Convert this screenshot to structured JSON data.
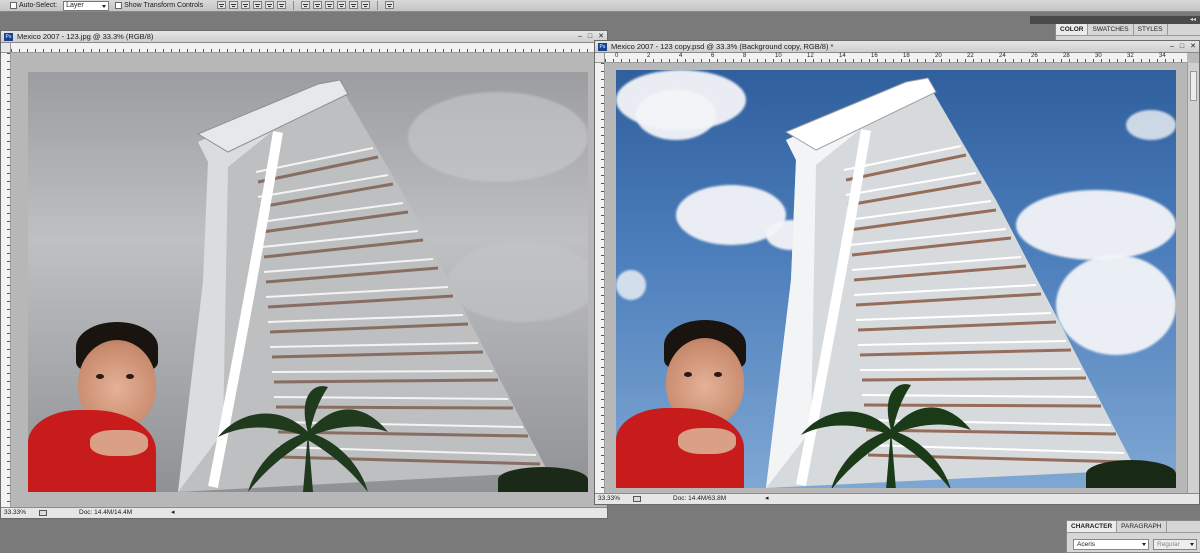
{
  "options_bar": {
    "auto_select_label": "Auto-Select:",
    "auto_select_value": "Layer",
    "show_transform_label": "Show Transform Controls"
  },
  "windows": [
    {
      "title": "Mexico 2007 - 123.jpg @ 33.3% (RGB/8)",
      "zoom": "33.33%",
      "doc_size": "Doc: 14.4M/14.4M"
    },
    {
      "title": "Mexico 2007 - 123 copy.psd @ 33.3% (Background copy, RGB/8) *",
      "zoom": "33.33%",
      "doc_size": "Doc: 14.4M/63.8M",
      "ruler_labels": [
        "0",
        "2",
        "4",
        "6",
        "8",
        "10",
        "12",
        "14",
        "16",
        "18",
        "20",
        "22",
        "24",
        "26",
        "28",
        "30",
        "32",
        "34"
      ]
    }
  ],
  "panels": {
    "color_tabs": [
      "COLOR",
      "SWATCHES",
      "STYLES"
    ],
    "character_tabs": [
      "CHARACTER",
      "PARAGRAPH"
    ],
    "font_family": "Aceris",
    "font_style": "Regular"
  },
  "colors": {
    "app_bg": "#7a7a7a",
    "shirt": "#c81b1b",
    "sky_blue": "#3b6aa8"
  }
}
